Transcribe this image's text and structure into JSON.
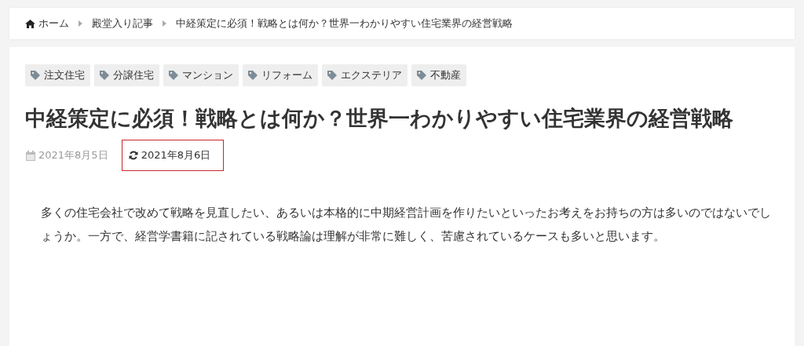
{
  "breadcrumb": [
    {
      "label": "ホーム",
      "kind": "home"
    },
    {
      "label": "殿堂入り記事",
      "kind": "link"
    },
    {
      "label": "中経策定に必須！戦略とは何か？世界一わかりやすい住宅業界の経営戦略",
      "kind": "current"
    }
  ],
  "tags": [
    "注文住宅",
    "分譲住宅",
    "マンション",
    "リフォーム",
    "エクステリア",
    "不動産"
  ],
  "title": "中経策定に必須！戦略とは何か？世界一わかりやすい住宅業界の経営戦略",
  "dates": [
    {
      "kind": "published",
      "text": "2021年8月5日",
      "highlighted": false
    },
    {
      "kind": "updated",
      "text": "2021年8月6日",
      "highlighted": true
    }
  ],
  "paragraph": "多くの住宅会社で改めて戦略を見直したい、あるいは本格的に中期経営計画を作りたいといったお考えをお持ちの方は多いのではないでしょうか。一方で、経営学書籍に記されている戦略論は理解が非常に難しく、苦慮されているケースも多いと思います。"
}
